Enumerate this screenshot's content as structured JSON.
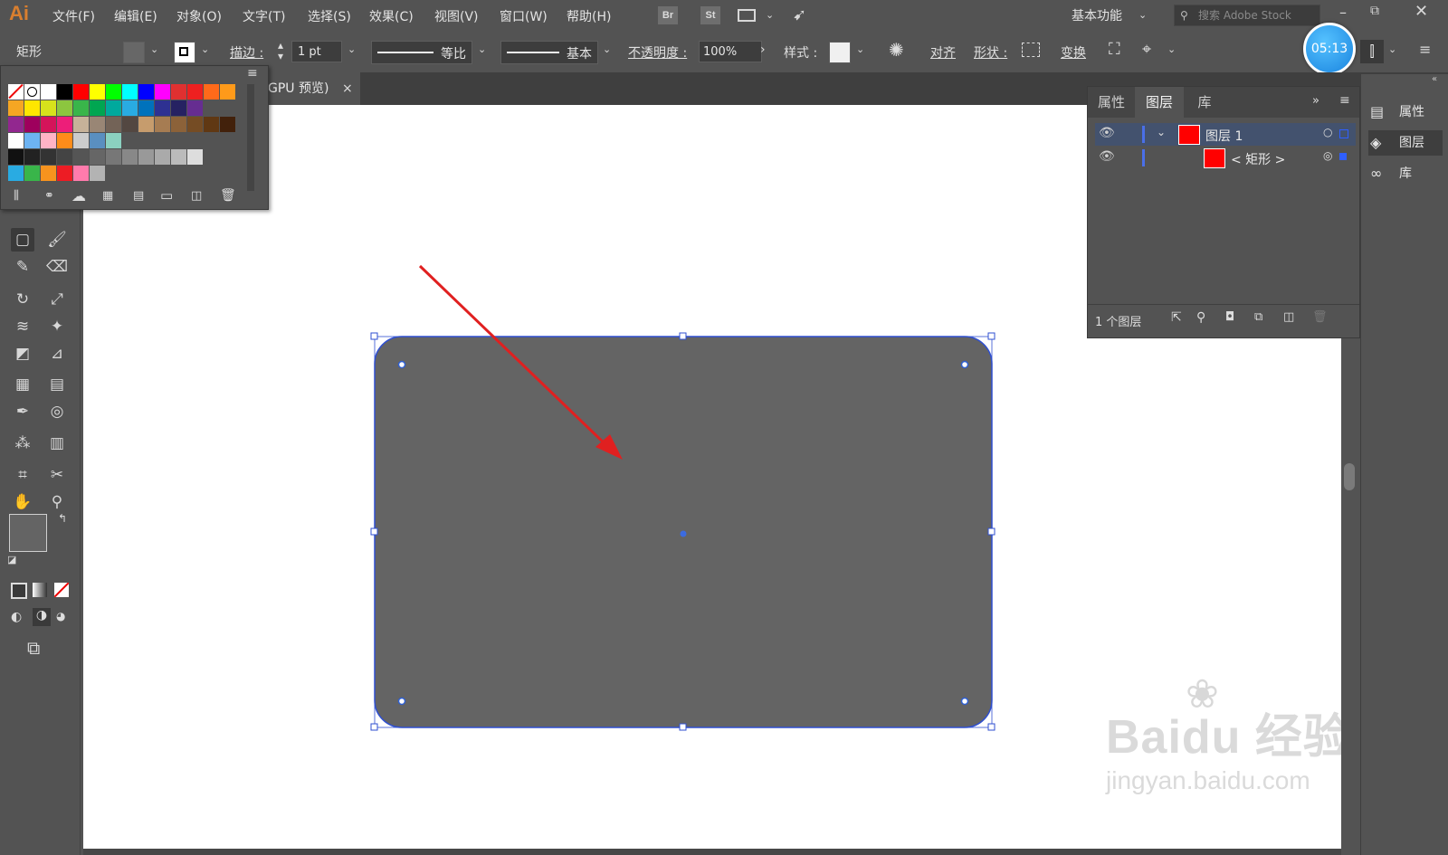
{
  "app": {
    "logo": "Ai"
  },
  "menu": [
    "文件(F)",
    "编辑(E)",
    "对象(O)",
    "文字(T)",
    "选择(S)",
    "效果(C)",
    "视图(V)",
    "窗口(W)",
    "帮助(H)"
  ],
  "menu_icons": {
    "bridge": "Br",
    "stock": "St"
  },
  "workspace": "基本功能",
  "search_placeholder": "搜索 Adobe Stock",
  "timer": "05:13",
  "control": {
    "object_type": "矩形",
    "stroke_label": "描边 :",
    "stroke_value": "1 pt",
    "profile_label": "等比",
    "brush_label": "基本",
    "opacity_label": "不透明度 :",
    "opacity_value": "100%",
    "style_label": "样式 :",
    "align_label": "对齐",
    "shape_label": "形状 :",
    "transform_label": "变换"
  },
  "doc_tab": {
    "title": "GPU 预览)",
    "close": "×"
  },
  "layers_panel": {
    "tabs": [
      "属性",
      "图层",
      "库"
    ],
    "active_tab": "图层",
    "rows": [
      {
        "name": "图层 1",
        "color": "#ff0000"
      },
      {
        "name": "< 矩形 >",
        "color": "#ff0000"
      }
    ],
    "footer_count": "1 个图层"
  },
  "dock": [
    "属性",
    "图层",
    "库"
  ],
  "artboard_shape": {
    "fill": "#646464",
    "stroke": "#2f4fd0",
    "type": "rounded rectangle"
  },
  "annotation_arrow": {
    "color": "#e02020"
  },
  "watermark": {
    "line1": "Baidu 经验",
    "line2": "jingyan.baidu.com"
  },
  "colors": {
    "accent": "#2f5fd0",
    "ui_bg": "#535353",
    "canvas": "#ffffff"
  }
}
